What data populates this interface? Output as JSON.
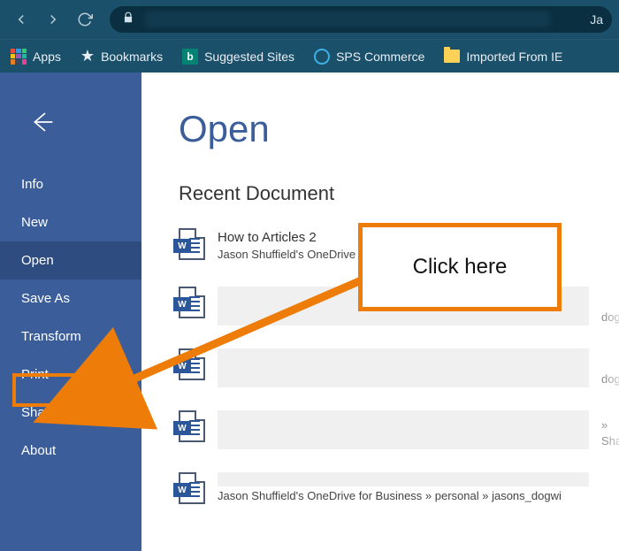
{
  "browser": {
    "url_hint": "Ja"
  },
  "bookmarks": {
    "apps": "Apps",
    "bookmarks": "Bookmarks",
    "suggested": "Suggested Sites",
    "sps": "SPS Commerce",
    "imported": "Imported From IE"
  },
  "sidebar": {
    "items": [
      {
        "label": "Info"
      },
      {
        "label": "New"
      },
      {
        "label": "Open"
      },
      {
        "label": "Save As"
      },
      {
        "label": "Transform"
      },
      {
        "label": "Print"
      },
      {
        "label": "Share"
      },
      {
        "label": "About"
      }
    ]
  },
  "main": {
    "title": "Open",
    "section": "Recent Document",
    "docs": [
      {
        "name": "How to Articles 2",
        "path": "Jason Shuffield's OneDrive for Business » personal » jasons_dogwi"
      },
      {
        "name": "",
        "path": "dogw"
      },
      {
        "name": "",
        "path": "dogw"
      },
      {
        "name": "",
        "path": "» Sha"
      },
      {
        "name": "",
        "path": "Jason Shuffield's OneDrive for Business » personal » jasons_dogwi"
      }
    ]
  },
  "callout": {
    "text": "Click here"
  }
}
